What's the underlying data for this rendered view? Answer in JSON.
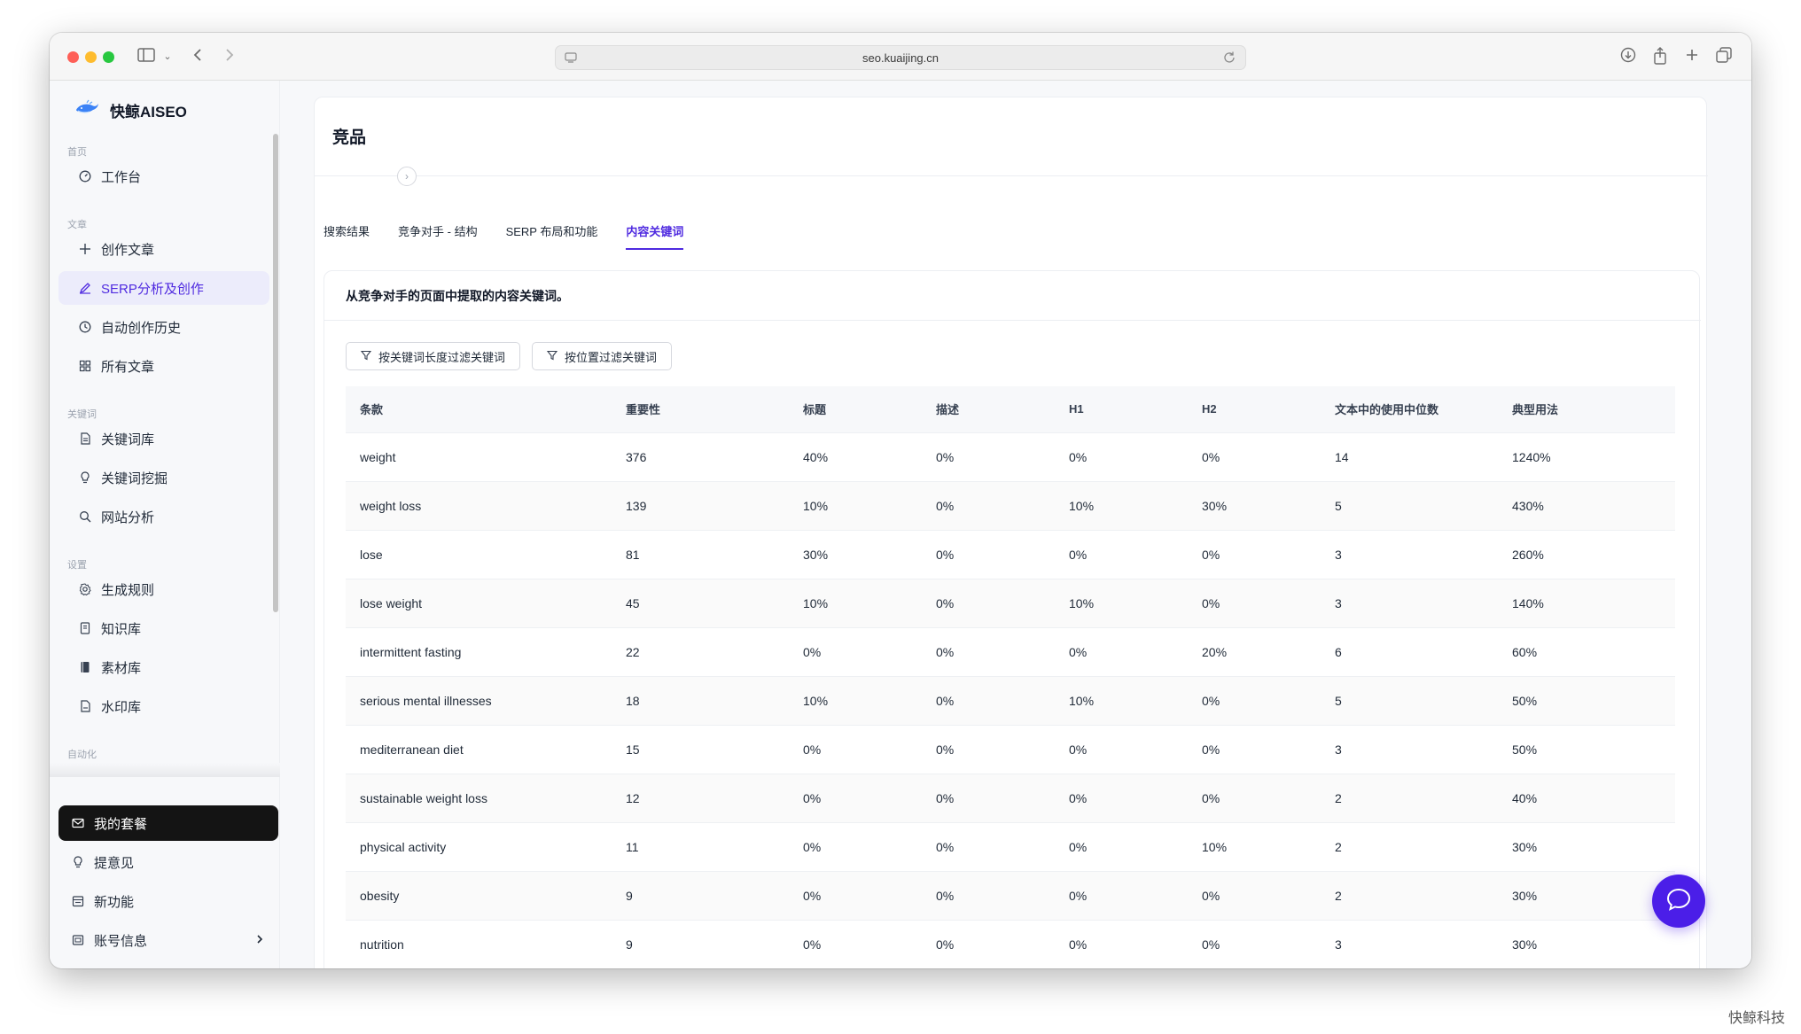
{
  "browser": {
    "url": "seo.kuaijing.cn"
  },
  "sidebar": {
    "brand": "快鲸AISEO",
    "sections": [
      {
        "label": "首页",
        "items": [
          {
            "label": "工作台",
            "icon": "dashboard-icon"
          }
        ]
      },
      {
        "label": "文章",
        "items": [
          {
            "label": "创作文章",
            "icon": "plus-icon"
          },
          {
            "label": "SERP分析及创作",
            "icon": "pencil-icon",
            "active": true
          },
          {
            "label": "自动创作历史",
            "icon": "clock-icon"
          },
          {
            "label": "所有文章",
            "icon": "grid-icon"
          }
        ]
      },
      {
        "label": "关键词",
        "items": [
          {
            "label": "关键词库",
            "icon": "document-icon"
          },
          {
            "label": "关键词挖掘",
            "icon": "bulb-icon"
          },
          {
            "label": "网站分析",
            "icon": "search-icon"
          }
        ]
      },
      {
        "label": "设置",
        "items": [
          {
            "label": "生成规则",
            "icon": "gear-icon"
          },
          {
            "label": "知识库",
            "icon": "notebook-icon"
          },
          {
            "label": "素材库",
            "icon": "book-icon"
          },
          {
            "label": "水印库",
            "icon": "file-icon"
          }
        ]
      },
      {
        "label": "自动化",
        "items": []
      }
    ],
    "bottom": [
      {
        "label": "我的套餐",
        "icon": "mail-icon"
      },
      {
        "label": "提意见",
        "icon": "bulb-icon"
      },
      {
        "label": "新功能",
        "icon": "calendar-icon"
      },
      {
        "label": "账号信息",
        "icon": "id-card-icon"
      }
    ]
  },
  "main": {
    "title": "竞品",
    "tabs": [
      "搜索结果",
      "竞争对手 - 结构",
      "SERP 布局和功能",
      "内容关键词"
    ],
    "active_tab": 3,
    "panel_heading": "从竞争对手的页面中提取的内容关键词。",
    "filters": [
      "按关键词长度过滤关键词",
      "按位置过滤关键词"
    ],
    "table": {
      "columns": [
        "条款",
        "重要性",
        "标题",
        "描述",
        "H1",
        "H2",
        "文本中的使用中位数",
        "典型用法"
      ],
      "rows": [
        [
          "weight",
          "376",
          "40%",
          "0%",
          "0%",
          "0%",
          "14",
          "1240%"
        ],
        [
          "weight loss",
          "139",
          "10%",
          "0%",
          "10%",
          "30%",
          "5",
          "430%"
        ],
        [
          "lose",
          "81",
          "30%",
          "0%",
          "0%",
          "0%",
          "3",
          "260%"
        ],
        [
          "lose weight",
          "45",
          "10%",
          "0%",
          "10%",
          "0%",
          "3",
          "140%"
        ],
        [
          "intermittent fasting",
          "22",
          "0%",
          "0%",
          "0%",
          "20%",
          "6",
          "60%"
        ],
        [
          "serious mental illnesses",
          "18",
          "10%",
          "0%",
          "10%",
          "0%",
          "5",
          "50%"
        ],
        [
          "mediterranean diet",
          "15",
          "0%",
          "0%",
          "0%",
          "0%",
          "3",
          "50%"
        ],
        [
          "sustainable weight loss",
          "12",
          "0%",
          "0%",
          "0%",
          "0%",
          "2",
          "40%"
        ],
        [
          "physical activity",
          "11",
          "0%",
          "0%",
          "0%",
          "10%",
          "2",
          "30%"
        ],
        [
          "obesity",
          "9",
          "0%",
          "0%",
          "0%",
          "0%",
          "2",
          "30%"
        ],
        [
          "nutrition",
          "9",
          "0%",
          "0%",
          "0%",
          "0%",
          "3",
          "30%"
        ]
      ]
    }
  },
  "watermark": "快鲸科技",
  "colors": {
    "accent": "#4f2ae0",
    "fab": "#4b1ee8",
    "dark": "#141414"
  }
}
